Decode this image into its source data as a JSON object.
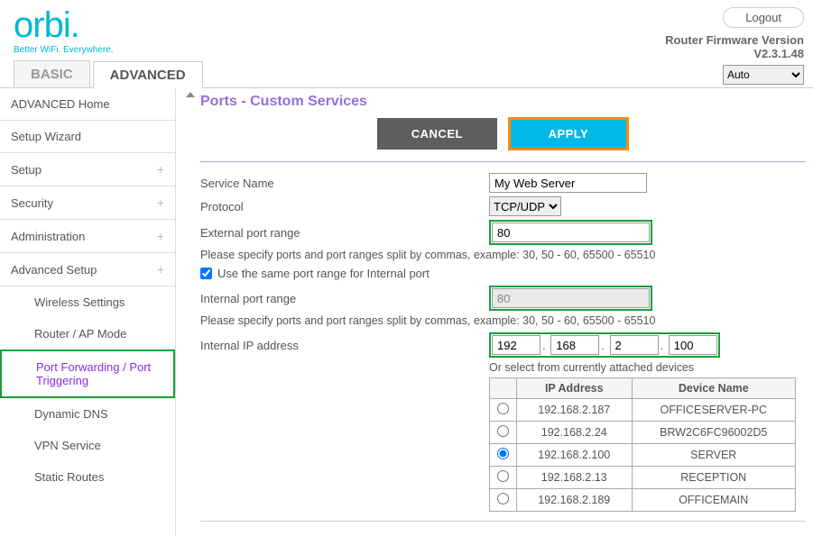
{
  "header": {
    "logo": "orbi",
    "tagline": "Better WiFi. Everywhere.",
    "logout": "Logout",
    "fw_label": "Router Firmware Version",
    "fw_version": "V2.3.1.48",
    "lang_selected": "Auto"
  },
  "tabs": {
    "basic": "BASIC",
    "advanced": "ADVANCED"
  },
  "sidebar": {
    "items": [
      {
        "label": "ADVANCED Home",
        "expandable": false
      },
      {
        "label": "Setup Wizard",
        "expandable": false
      },
      {
        "label": "Setup",
        "expandable": true
      },
      {
        "label": "Security",
        "expandable": true
      },
      {
        "label": "Administration",
        "expandable": true
      },
      {
        "label": "Advanced Setup",
        "expandable": true
      }
    ],
    "sub": [
      {
        "label": "Wireless Settings"
      },
      {
        "label": "Router / AP Mode"
      },
      {
        "label": "Port Forwarding / Port Triggering"
      },
      {
        "label": "Dynamic DNS"
      },
      {
        "label": "VPN Service"
      },
      {
        "label": "Static Routes"
      }
    ]
  },
  "page": {
    "title": "Ports - Custom Services",
    "cancel": "CANCEL",
    "apply": "APPLY",
    "service_name_label": "Service Name",
    "service_name_value": "My Web Server",
    "protocol_label": "Protocol",
    "protocol_value": "TCP/UDP",
    "ext_label": "External port range",
    "ext_value": "80",
    "hint": "Please specify ports and port ranges split by commas, example: 30, 50 - 60, 65500 - 65510",
    "same_port_label": "Use the same port range for Internal port",
    "int_label": "Internal port range",
    "int_value": "80",
    "ip_label": "Internal IP address",
    "ip": [
      "192",
      "168",
      "2",
      "100"
    ],
    "device_hint": "Or select from currently attached devices",
    "table": {
      "col_ip": "IP Address",
      "col_name": "Device Name",
      "rows": [
        {
          "ip": "192.168.2.187",
          "name": "OFFICESERVER-PC",
          "selected": false
        },
        {
          "ip": "192.168.2.24",
          "name": "BRW2C6FC96002D5",
          "selected": false
        },
        {
          "ip": "192.168.2.100",
          "name": "SERVER",
          "selected": true
        },
        {
          "ip": "192.168.2.13",
          "name": "RECEPTION",
          "selected": false
        },
        {
          "ip": "192.168.2.189",
          "name": "OFFICEMAIN",
          "selected": false
        }
      ]
    }
  }
}
